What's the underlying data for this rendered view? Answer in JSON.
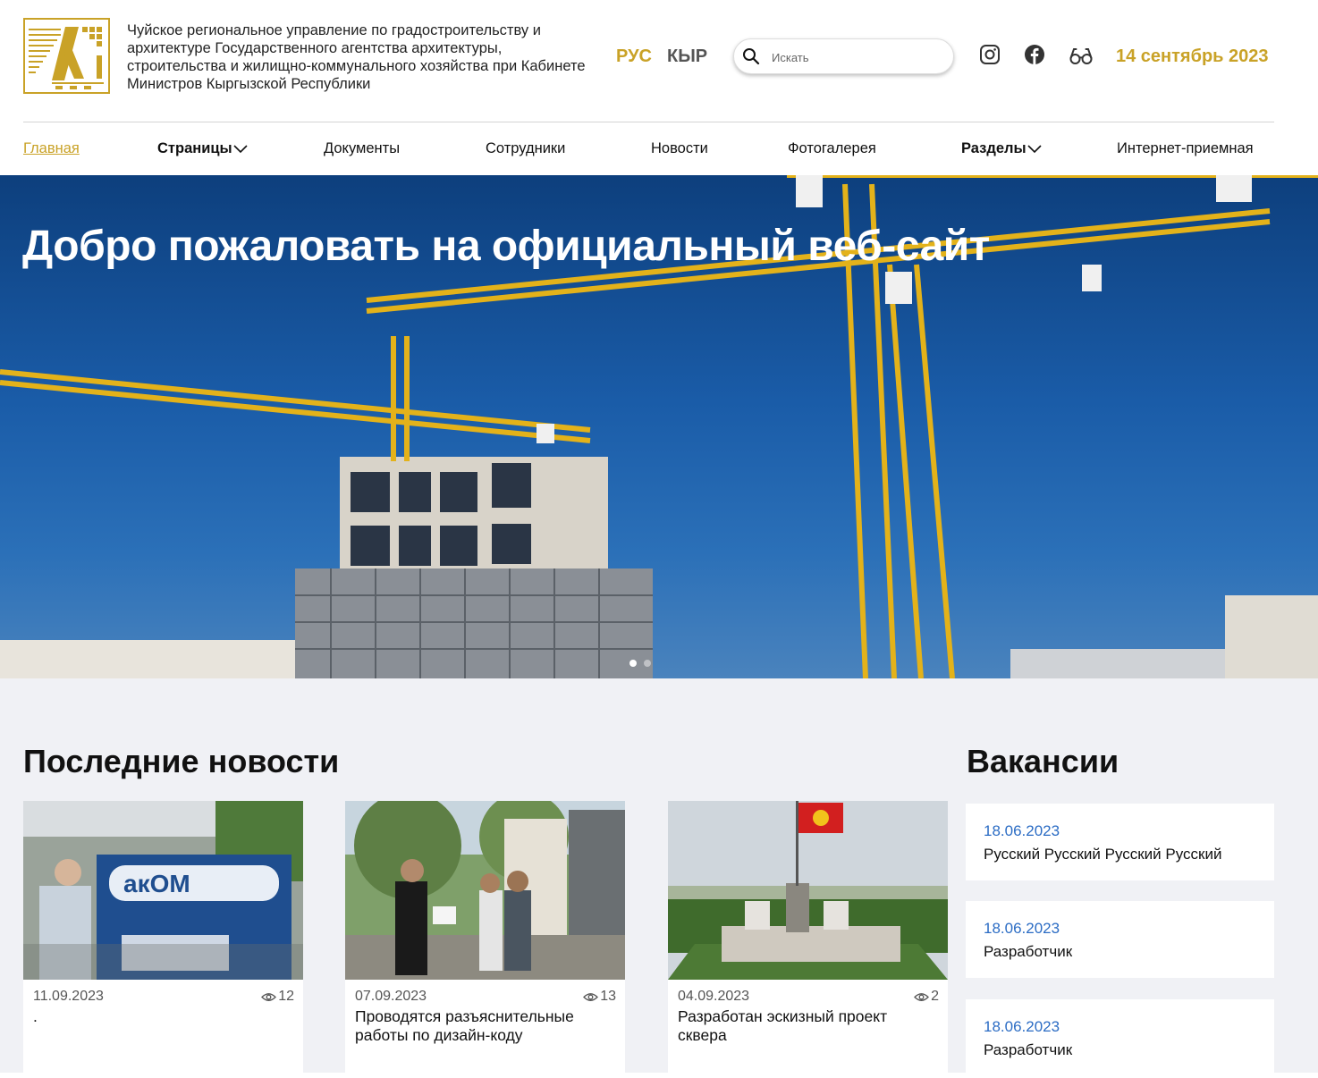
{
  "header": {
    "org_name": "Чуйское региональное управление по градостроительству и архитектуре Государственного агентства архитектуры, строительства и жилищно-коммунального хозяйства при Кабинете Министров Кыргызской Республики",
    "lang_ru": "РУС",
    "lang_ky": "КЫР",
    "search_placeholder": "Искать",
    "date": "14 сентябрь 2023",
    "icons": [
      "instagram-icon",
      "facebook-icon",
      "glasses-icon",
      "search-icon"
    ]
  },
  "nav": {
    "items": [
      {
        "label": "Главная"
      },
      {
        "label": "Страницы"
      },
      {
        "label": "Документы"
      },
      {
        "label": "Сотрудники"
      },
      {
        "label": "Новости"
      },
      {
        "label": "Фотогалерея"
      },
      {
        "label": "Разделы"
      },
      {
        "label": "Интернет-приемная"
      }
    ]
  },
  "hero": {
    "title": "Добро пожаловать на официальный веб-сайт"
  },
  "news": {
    "title": "Последние новости",
    "items": [
      {
        "date": "11.09.2023",
        "views": "12",
        "title": "."
      },
      {
        "date": "07.09.2023",
        "views": "13",
        "title": "Проводятся разъяснительные работы по дизайн-коду"
      },
      {
        "date": "04.09.2023",
        "views": "2",
        "title": "Разработан эскизный проект сквера"
      }
    ]
  },
  "vacancies": {
    "title": "Вакансии",
    "items": [
      {
        "date": "18.06.2023",
        "title": "Русский Русский Русский Русский"
      },
      {
        "date": "18.06.2023",
        "title": "Разработчик"
      },
      {
        "date": "18.06.2023",
        "title": "Разработчик"
      }
    ]
  },
  "colors": {
    "accent_gold": "#c9a227",
    "link_blue": "#2b6cc4",
    "content_bg": "#f0f1f5"
  }
}
